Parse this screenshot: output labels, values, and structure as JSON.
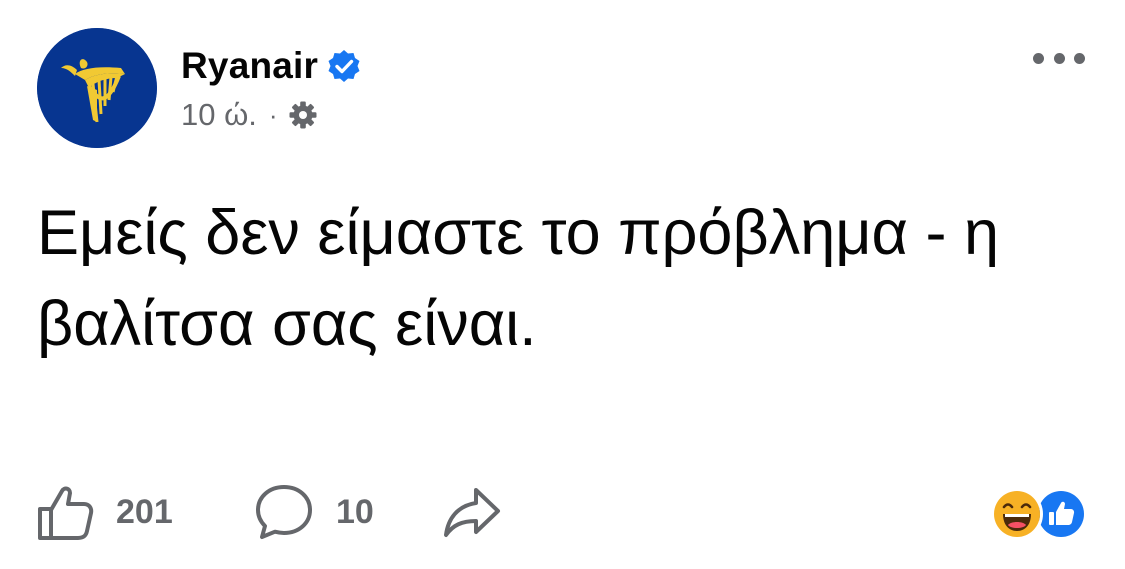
{
  "post": {
    "page_name": "Ryanair",
    "time": "10 ώ.",
    "separator": "·",
    "text": "Εμείς δεν είμαστε το πρόβλημα - η βαλίτσα σας είναι."
  },
  "actions": {
    "like_count": "201",
    "comment_count": "10"
  },
  "icons": {
    "avatar": "ryanair-harp-logo",
    "verified": "verified-badge-icon",
    "audience": "gear-icon",
    "more": "more-options-icon",
    "like": "thumbs-up-icon",
    "comment": "comment-bubble-icon",
    "share": "share-arrow-icon",
    "reactions": [
      "haha-reaction-icon",
      "like-reaction-icon"
    ]
  },
  "colors": {
    "text_primary": "#050505",
    "text_secondary": "#65676b",
    "brand_blue": "#073590",
    "brand_yellow": "#f1c933",
    "fb_blue": "#1877f2",
    "reaction_yellow": "#f7b125"
  }
}
